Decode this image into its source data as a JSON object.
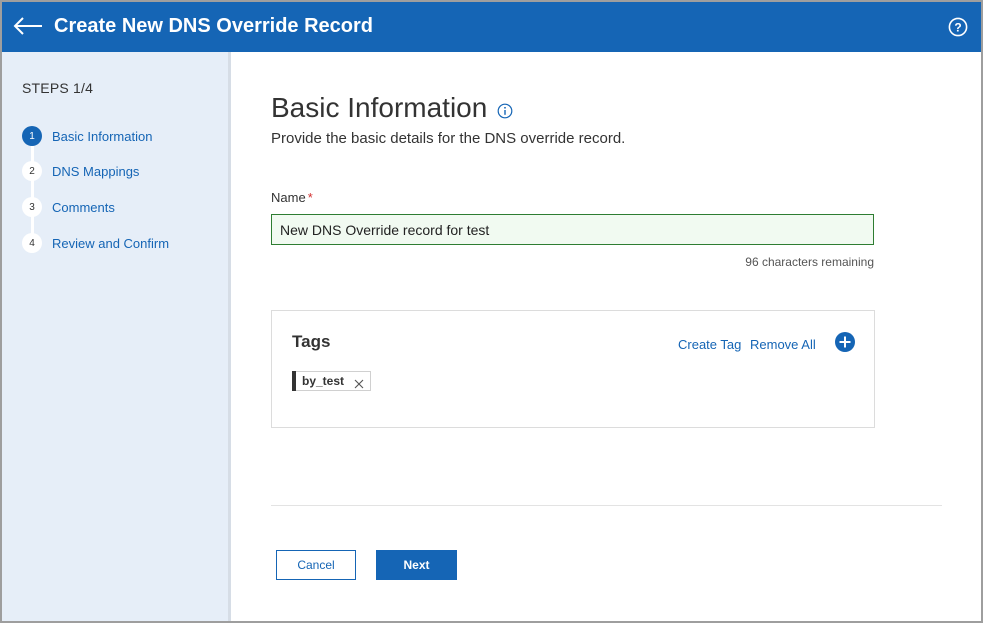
{
  "header": {
    "title": "Create New DNS Override Record",
    "back_icon": "arrow-left-icon",
    "help_icon": "help-circle-icon",
    "color": "#1565b5"
  },
  "sidebar": {
    "steps_title": "STEPS 1/4",
    "steps": [
      {
        "number": "1",
        "label": "Basic Information",
        "active": true
      },
      {
        "number": "2",
        "label": "DNS Mappings",
        "active": false
      },
      {
        "number": "3",
        "label": "Comments",
        "active": false
      },
      {
        "number": "4",
        "label": "Review and Confirm",
        "active": false
      }
    ]
  },
  "main": {
    "heading": "Basic Information",
    "info_icon": "info-icon",
    "subtitle": "Provide the basic details for the DNS override record.",
    "name_field": {
      "label": "Name",
      "required_mark": "*",
      "value": "New DNS Override record for test",
      "remaining": "96 characters remaining"
    },
    "tags": {
      "title": "Tags",
      "create_tag": "Create Tag",
      "remove_all": "Remove All",
      "add_icon": "plus-circle-icon",
      "items": [
        {
          "label": "by_test"
        }
      ]
    },
    "buttons": {
      "cancel": "Cancel",
      "next": "Next"
    }
  }
}
